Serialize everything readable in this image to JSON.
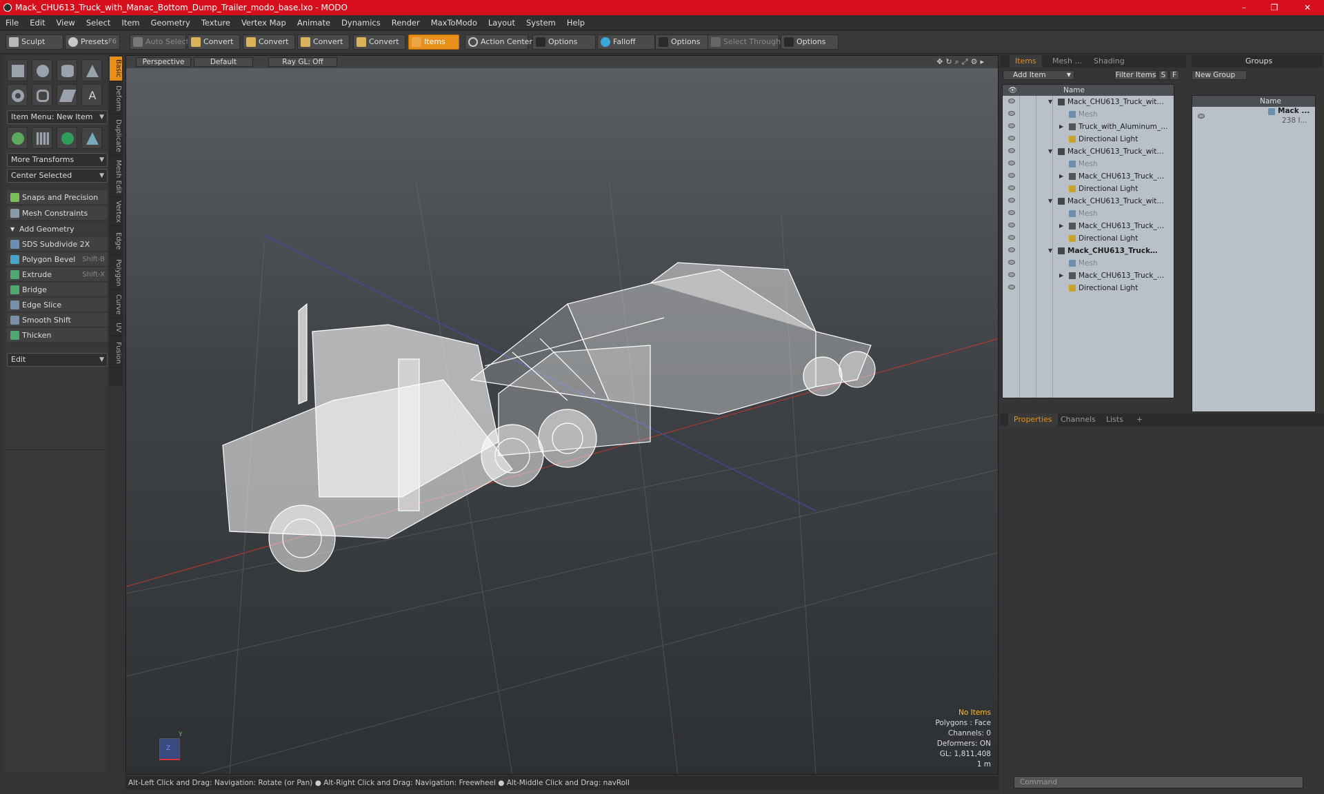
{
  "window": {
    "title": "Mack_CHU613_Truck_with_Manac_Bottom_Dump_Trailer_modo_base.lxo - MODO",
    "minimize": "–",
    "maximize": "❐",
    "close": "✕"
  },
  "menu": [
    "File",
    "Edit",
    "View",
    "Select",
    "Item",
    "Geometry",
    "Texture",
    "Vertex Map",
    "Animate",
    "Dynamics",
    "Render",
    "MaxToModo",
    "Layout",
    "System",
    "Help"
  ],
  "toolbar": {
    "sculpt": "Sculpt",
    "presets": "Presets",
    "presets_key": "F6",
    "auto_select": "Auto Select",
    "convert1": "Convert",
    "convert2": "Convert",
    "convert3": "Convert",
    "convert4": "Convert",
    "items": "Items",
    "action_center": "Action Center",
    "options1": "Options",
    "falloff": "Falloff",
    "options2": "Options",
    "select_through": "Select Through",
    "options3": "Options"
  },
  "left_tabs": [
    "Basic",
    "Deform",
    "Duplicate",
    "Mesh Edit",
    "Vertex",
    "Edge",
    "Polygon",
    "Curve",
    "UV",
    "Fusion"
  ],
  "left_panel": {
    "item_menu": "Item Menu: New Item",
    "more_transforms": "More Transforms",
    "center_selected": "Center Selected",
    "snaps": "Snaps and Precision",
    "mesh_constraints": "Mesh Constraints",
    "add_geometry": "Add Geometry",
    "tools": [
      {
        "label": "SDS Subdivide 2X",
        "shortcut": ""
      },
      {
        "label": "Polygon Bevel",
        "shortcut": "Shift-B"
      },
      {
        "label": "Extrude",
        "shortcut": "Shift-X"
      },
      {
        "label": "Bridge",
        "shortcut": ""
      },
      {
        "label": "Edge Slice",
        "shortcut": ""
      },
      {
        "label": "Smooth Shift",
        "shortcut": ""
      },
      {
        "label": "Thicken",
        "shortcut": ""
      }
    ],
    "edit": "Edit"
  },
  "viewport": {
    "perspective": "Perspective",
    "default": "Default",
    "raygl": "Ray GL: Off",
    "info": {
      "no_items": "No Items",
      "polygons": "Polygons : Face",
      "channels": "Channels: 0",
      "deformers": "Deformers: ON",
      "gl": "GL: 1,811,408",
      "scale": "1 m"
    },
    "axis_y": "Y",
    "axis_z": "Z"
  },
  "status_bar": "Alt-Left Click and Drag: Navigation: Rotate (or Pan) ●  Alt-Right Click and Drag: Navigation: Freewheel ●  Alt-Middle Click and Drag: navRoll",
  "items_panel": {
    "tabs": [
      "Items",
      "Mesh ...",
      "Shading"
    ],
    "add_item": "Add Item",
    "filter_items": "Filter Items",
    "s": "S",
    "f": "F",
    "name_header": "Name",
    "rows": [
      {
        "name": "Mack_CHU613_Truck_wit…",
        "indent": 0,
        "type": "scene",
        "style": "normal"
      },
      {
        "name": "Mesh",
        "indent": 1,
        "type": "mesh",
        "style": "gray"
      },
      {
        "name": "Truck_with_Aluminum_…",
        "indent": 1,
        "type": "group",
        "style": "normal"
      },
      {
        "name": "Directional Light",
        "indent": 1,
        "type": "light",
        "style": "normal"
      },
      {
        "name": "Mack_CHU613_Truck_wit…",
        "indent": 0,
        "type": "scene",
        "style": "normal"
      },
      {
        "name": "Mesh",
        "indent": 1,
        "type": "mesh",
        "style": "gray"
      },
      {
        "name": "Mack_CHU613_Truck_…",
        "indent": 1,
        "type": "group",
        "style": "normal"
      },
      {
        "name": "Directional Light",
        "indent": 1,
        "type": "light",
        "style": "normal"
      },
      {
        "name": "Mack_CHU613_Truck_wit…",
        "indent": 0,
        "type": "scene",
        "style": "normal"
      },
      {
        "name": "Mesh",
        "indent": 1,
        "type": "mesh",
        "style": "gray"
      },
      {
        "name": "Mack_CHU613_Truck_…",
        "indent": 1,
        "type": "group",
        "style": "normal"
      },
      {
        "name": "Directional Light",
        "indent": 1,
        "type": "light",
        "style": "normal"
      },
      {
        "name": "Mack_CHU613_Truck…",
        "indent": 0,
        "type": "scene",
        "style": "bold"
      },
      {
        "name": "Mesh",
        "indent": 1,
        "type": "mesh",
        "style": "gray"
      },
      {
        "name": "Mack_CHU613_Truck_…",
        "indent": 1,
        "type": "group",
        "style": "normal"
      },
      {
        "name": "Directional Light",
        "indent": 1,
        "type": "light",
        "style": "normal"
      }
    ]
  },
  "groups_panel": {
    "title": "Groups",
    "new_group": "New Group",
    "name_header": "Name",
    "row_name": "Mack ...",
    "row_sub": "238 I..."
  },
  "properties_panel": {
    "tabs": [
      "Properties",
      "Channels",
      "Lists"
    ],
    "add": "+"
  },
  "command": {
    "placeholder": "Command"
  },
  "colors": {
    "accent": "#e88f1a",
    "titlebar": "#d70f1c"
  }
}
